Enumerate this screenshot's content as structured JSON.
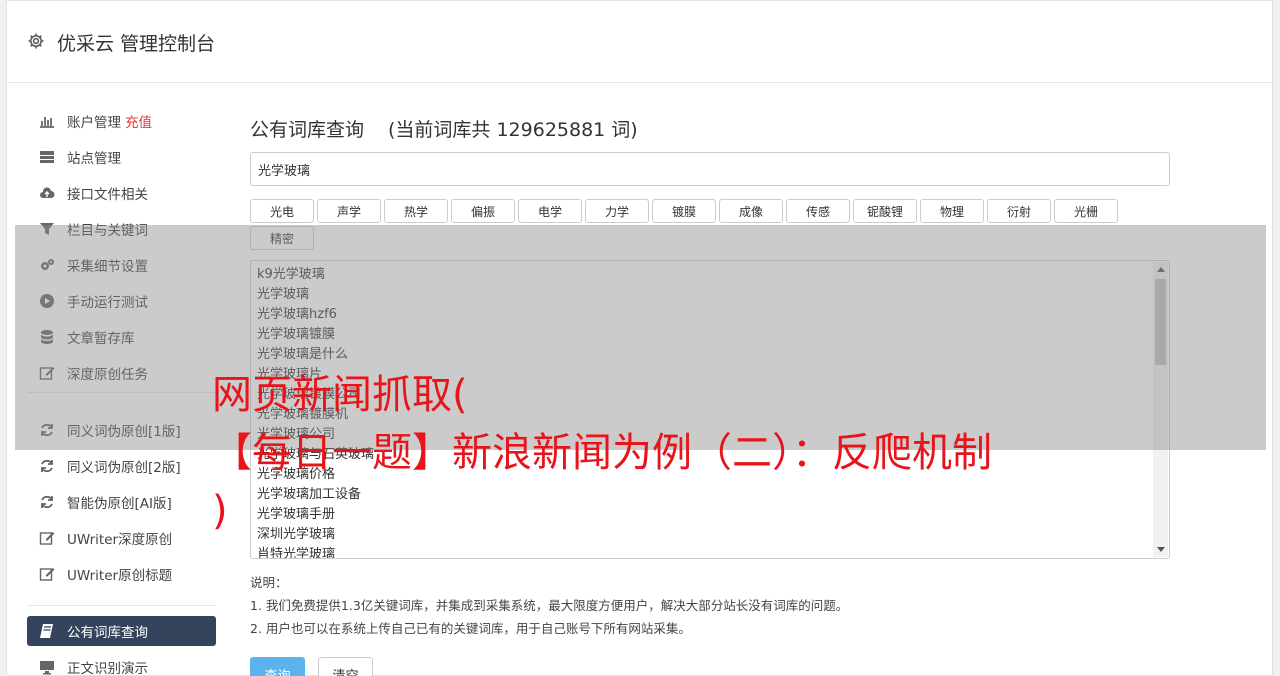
{
  "header": {
    "title": "优采云 管理控制台",
    "icon": "gear-icon"
  },
  "sidebar": {
    "items": [
      {
        "label": "账户管理",
        "tag": "充值",
        "icon": "bar-chart-icon"
      },
      {
        "label": "站点管理",
        "icon": "server-icon"
      },
      {
        "label": "接口文件相关",
        "icon": "cloud-upload-icon"
      },
      {
        "label": "栏目与关键词",
        "icon": "filter-icon"
      },
      {
        "label": "采集细节设置",
        "icon": "gears-icon"
      },
      {
        "label": "手动运行测试",
        "icon": "play-circle-icon"
      },
      {
        "label": "文章暂存库",
        "icon": "database-icon"
      },
      {
        "label": "深度原创任务",
        "icon": "edit-icon"
      },
      {
        "label": "同义词伪原创[1版]",
        "icon": "refresh-icon"
      },
      {
        "label": "同义词伪原创[2版]",
        "icon": "refresh-icon"
      },
      {
        "label": "智能伪原创[AI版]",
        "icon": "refresh-icon"
      },
      {
        "label": "UWriter深度原创",
        "icon": "edit-icon"
      },
      {
        "label": "UWriter原创标题",
        "icon": "edit-icon"
      },
      {
        "label": "公有词库查询",
        "icon": "book-icon",
        "active": true
      },
      {
        "label": "正文识别演示",
        "icon": "monitor-icon"
      }
    ]
  },
  "main": {
    "title": "公有词库查询",
    "count": "(当前词库共 129625881 词)",
    "search_value": "光学玻璃",
    "tags": [
      "光电",
      "声学",
      "热学",
      "偏振",
      "电学",
      "力学",
      "镀膜",
      "成像",
      "传感",
      "铌酸锂",
      "物理",
      "衍射",
      "光栅",
      "精密"
    ],
    "results": [
      "k9光学玻璃",
      "光学玻璃",
      "光学玻璃hzf6",
      "光学玻璃镀膜",
      "光学玻璃是什么",
      "光学玻璃片",
      "光学玻璃镀膜公司",
      "光学玻璃镀膜机",
      "光学玻璃公司",
      "光学玻璃与石英玻璃",
      "光学玻璃价格",
      "光学玻璃加工设备",
      "光学玻璃手册",
      "深圳光学玻璃",
      "肖特光学玻璃"
    ],
    "notes_title": "说明：",
    "notes": [
      "1. 我们免费提供1.3亿关键词库，并集成到采集系统，最大限度方便用户，解决大部分站长没有词库的问题。",
      "2. 用户也可以在系统上传自己已有的关键词库，用于自己账号下所有网站采集。"
    ],
    "query_label": "查询",
    "clear_label": "清空"
  },
  "overlay": {
    "lines": [
      "网页新闻抓取(",
      "【每日一题】新浪新闻为例（二）：反爬机制",
      ")"
    ]
  }
}
